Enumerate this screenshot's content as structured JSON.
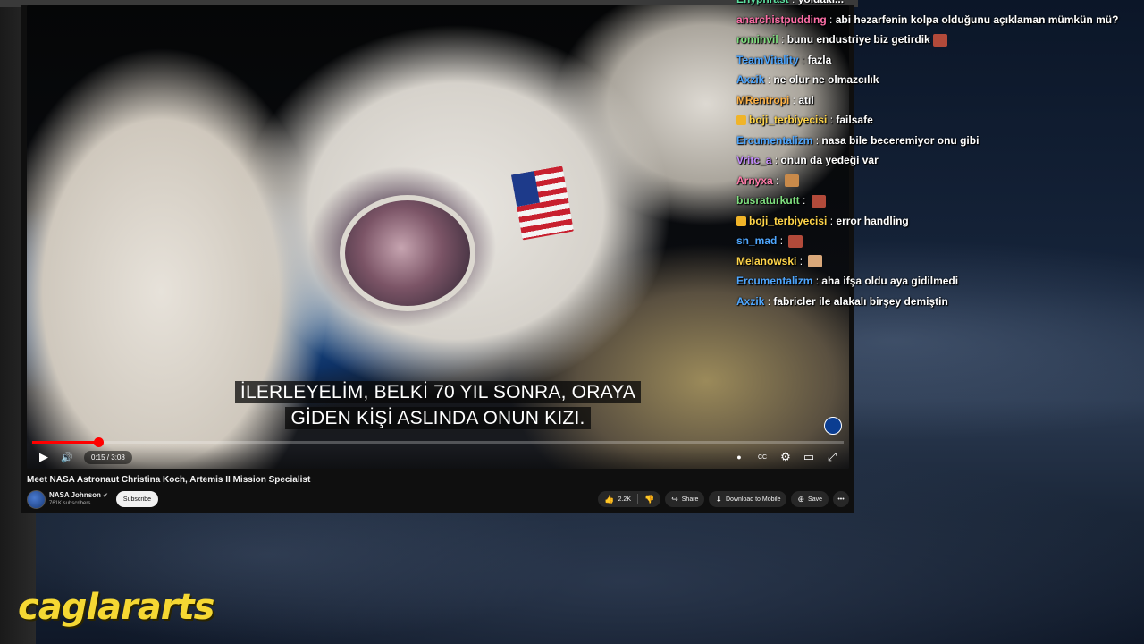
{
  "video": {
    "subtitle_line1": "İLERLEYELİM, BELKİ 70 YIL SONRA, ORAYA",
    "subtitle_line2": "GİDEN KİŞİ ASLINDA ONUN KIZI.",
    "time": "0:15 / 3:08",
    "progress_fraction": 0.081,
    "title": "Meet NASA Astronaut Christina Koch, Artemis II Mission Specialist"
  },
  "channel": {
    "name": "NASA Johnson",
    "verified_glyph": "✔",
    "subscribers": "761K subscribers",
    "subscribe_label": "Subscribe"
  },
  "actions": {
    "likes": "2.2K",
    "share": "Share",
    "download": "Download to Mobile",
    "save": "Save",
    "more": "•••"
  },
  "chat": [
    {
      "user": "Enyphrast",
      "color": "#5ce0a0",
      "msg": "yoldaki...",
      "emote": null,
      "crown": false
    },
    {
      "user": "anarchistpudding",
      "color": "#ff6fa8",
      "msg": "abi hezarfenin kolpa olduğunu açıklaman mümkün mü?",
      "emote": null,
      "crown": false
    },
    {
      "user": "rominvil",
      "color": "#7fe07f",
      "msg": "bunu endustriye biz getirdik",
      "emote": "#b24a3a",
      "crown": false
    },
    {
      "user": "TeamVitality",
      "color": "#4fa7ff",
      "msg": "fazla",
      "emote": null,
      "crown": false
    },
    {
      "user": "Axzik",
      "color": "#4fa7ff",
      "msg": "ne olur ne olmazcılık",
      "emote": null,
      "crown": false
    },
    {
      "user": "MRentropi",
      "color": "#ffb347",
      "msg": "atıl",
      "emote": null,
      "crown": false
    },
    {
      "user": "boji_terbiyecisi",
      "color": "#ffd54a",
      "msg": "failsafe",
      "emote": null,
      "crown": true
    },
    {
      "user": "Ercumentalizm",
      "color": "#4fa7ff",
      "msg": "nasa bile beceremiyor onu gibi",
      "emote": null,
      "crown": false
    },
    {
      "user": "Vritc_a",
      "color": "#c58cff",
      "msg": "onun da yedeği var",
      "emote": null,
      "crown": false
    },
    {
      "user": "Arnyxa",
      "color": "#ff7aa8",
      "msg": "",
      "emote": "#c98a4a",
      "crown": false
    },
    {
      "user": "busraturkutt",
      "color": "#7fe07f",
      "msg": "",
      "emote": "#b24a3a",
      "crown": false
    },
    {
      "user": "boji_terbiyecisi",
      "color": "#ffd54a",
      "msg": "error handling",
      "emote": null,
      "crown": true
    },
    {
      "user": "sn_mad",
      "color": "#4fa7ff",
      "msg": "",
      "emote": "#b24a3a",
      "crown": false
    },
    {
      "user": "Melanowski",
      "color": "#ffd54a",
      "msg": "",
      "emote": "#d9a87a",
      "crown": false
    },
    {
      "user": "Ercumentalizm",
      "color": "#4fa7ff",
      "msg": "aha ifşa oldu aya gidilmedi",
      "emote": null,
      "crown": false
    },
    {
      "user": "Axzik",
      "color": "#4fa7ff",
      "msg": "fabricler ile alakalı birşey demiştin",
      "emote": null,
      "crown": false
    }
  ],
  "brand": {
    "text": "caglararts",
    "color": "#f5d833"
  },
  "icons": {
    "play": "▶",
    "volume": "🔊",
    "autoplay": "●",
    "cc": "CC",
    "settings": "⚙",
    "miniplayer": "▭",
    "fullscreen": "⤢",
    "like": "👍",
    "dislike": "👎",
    "share": "↪",
    "download": "⬇",
    "save": "⊕"
  }
}
